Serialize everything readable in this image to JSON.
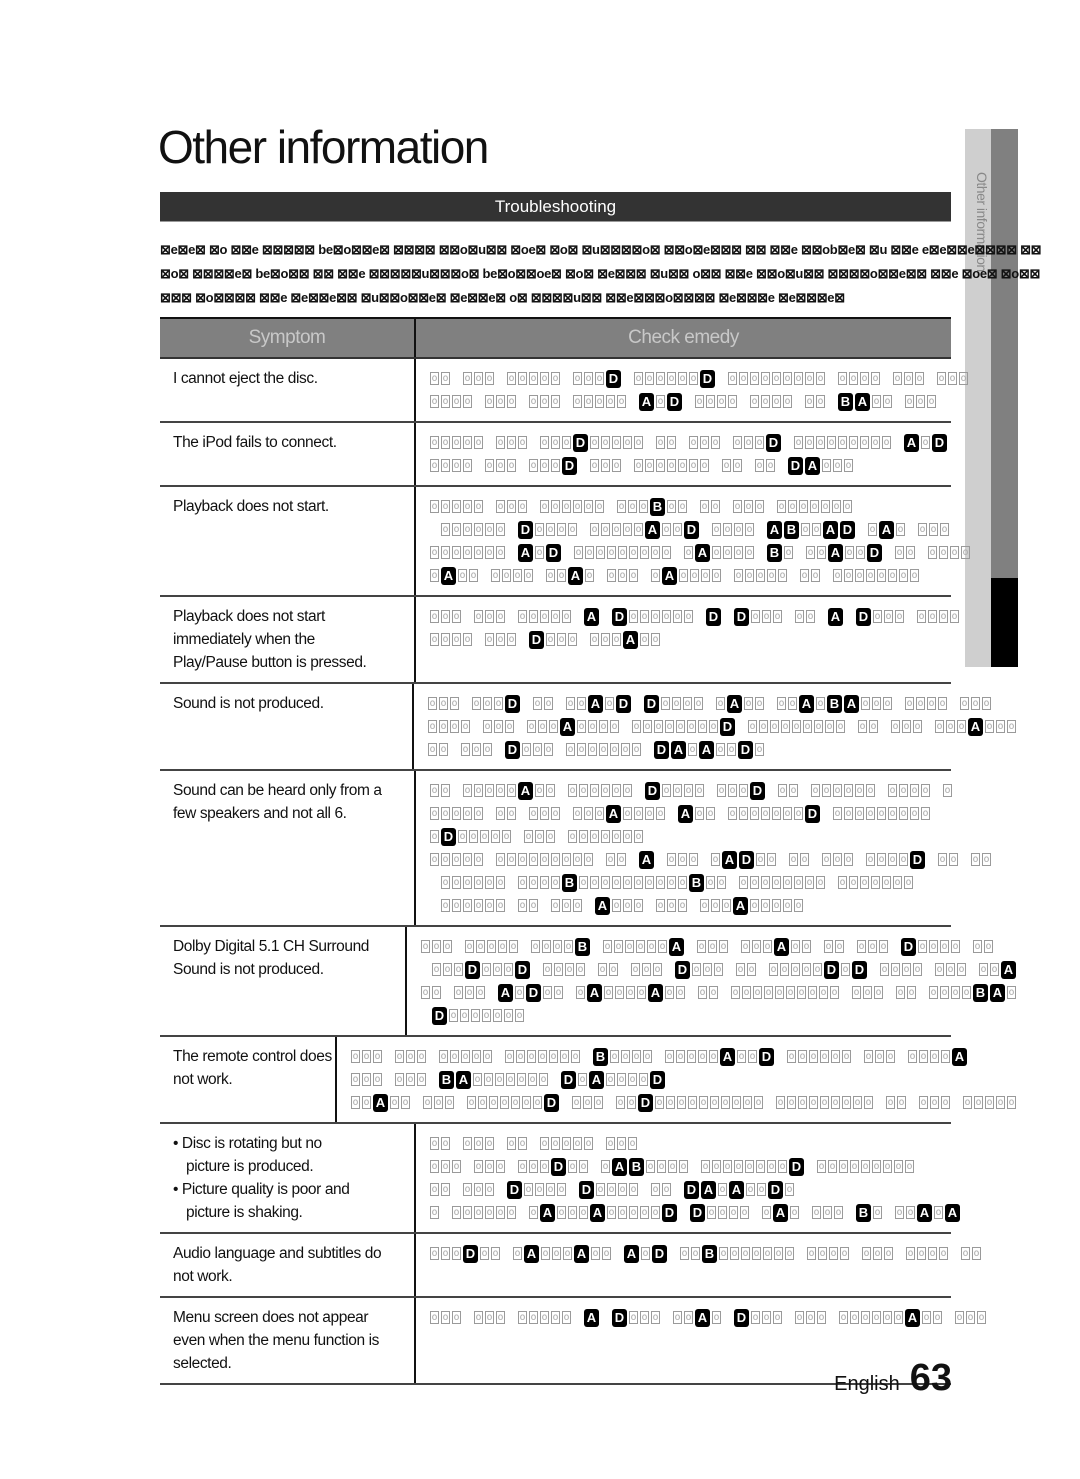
{
  "page": {
    "title": "Other information",
    "side_tab_label": "Other information",
    "section_title": "Troubleshooting",
    "intro_lines": [
      "⊠e⊠e⊠ ⊠o ⊠⊠e ⊠⊠⊠⊠⊠ be⊠o⊠⊠e⊠ ⊠⊠⊠⊠ ⊠⊠o⊠u⊠⊠ ⊠oe⊠ ⊠o⊠ ⊠u⊠⊠⊠⊠o⊠ ⊠⊠o⊠e⊠⊠⊠ ⊠⊠ ⊠⊠e ⊠⊠ob⊠e⊠ ⊠u ⊠⊠e e⊠e⊠⊠e⊠⊠⊠⊠ ⊠⊠",
      "⊠o⊠ ⊠⊠⊠⊠e⊠ be⊠o⊠⊠ ⊠⊠ ⊠⊠e ⊠⊠⊠⊠⊠u⊠⊠⊠o⊠ be⊠o⊠⊠oe⊠ ⊠o⊠ ⊠e⊠⊠⊠ ⊠u⊠⊠ o⊠⊠ ⊠⊠e ⊠⊠o⊠u⊠⊠ ⊠⊠⊠⊠o⊠⊠e⊠⊠ ⊠⊠e ⊠oe⊠ ⊠o⊠⊠",
      "⊠⊠⊠ ⊠o⊠⊠⊠⊠ ⊠⊠e ⊠e⊠⊠e⊠⊠ ⊠u⊠⊠o⊠⊠e⊠ ⊠e⊠⊠e⊠ o⊠ ⊠⊠⊠⊠u⊠⊠ ⊠⊠e⊠⊠⊠o⊠⊠⊠⊠ ⊠e⊠⊠⊠e ⊠e⊠⊠⊠e⊠"
    ],
    "table": {
      "col_symptom": "Symptom",
      "col_remedy": "Check emedy",
      "rows": [
        {
          "symptom": [
            "I cannot eject the disc."
          ],
          "remedy": [
            "oo ooo ooooo oooD ooooooD ooooooooo oooo ooo ooo",
            "oooo ooo ooo ooooo AoD oooo oooo oo BAoo ooo"
          ]
        },
        {
          "symptom": [
            "The iPod fails to connect."
          ],
          "remedy": [
            "ooooo ooo oooDooooo oo ooo oooD ooooooooo AoD",
            "oooo ooo oooD ooo ooooooo oo oo DAooo"
          ]
        },
        {
          "symptom": [
            "Playback does not start."
          ],
          "remedy": [
            "ooooo ooo oooooo oooBoo oo ooo ooooooo",
            " oooooo Doooo oooooAooD oooo ABooAD oAo ooo",
            "ooooooo AoD ooooooooo oAoooo Bo ooAooD oo oooo",
            "oAoo oooo ooAo ooo oAoooo ooooo oo oooooooo"
          ]
        },
        {
          "symptom": [
            "Playback does not start",
            "immediately when the",
            "Play/Pause button is pressed."
          ],
          "remedy": [
            "ooo ooo ooooo A Doooooo D Dooo oo A Dooo oooo",
            "oooo ooo Dooo oooAoo"
          ]
        },
        {
          "symptom": [
            "Sound is not produced."
          ],
          "remedy": [
            "ooo oooD oo ooAoD Doooo oAoo ooAoBAooo oooo ooo",
            "oooo ooo oooAoooo ooooooooD ooooooooo oo ooo oooAooo",
            "oo ooo Dooo ooooooo DAoAooDo"
          ]
        },
        {
          "symptom": [
            "Sound can be heard only from a",
            "few speakers and not all 6."
          ],
          "remedy": [
            "oo oooooAoo oooooo Doooo oooD oo oooooo oooo o",
            "ooooo oo ooo oooAoooo Aoo oooooooD ooooooooo",
            "oDooooo ooo ooooooo",
            "ooooo ooooooooo oo A ooo oADoo oo ooo ooooD oo oo",
            " oooooo ooooBooooooooooBoo oooooooo ooooooo",
            " oooooo oo ooo Aooo ooo oooAooooo"
          ]
        },
        {
          "symptom": [
            "Dolby Digital 5.1 CH Surround",
            "Sound is not produced."
          ],
          "remedy": [
            "ooo ooooo ooooB ooooooA ooo oooAoo oo ooo Doooo oo",
            " oooDoooD oooo oo ooo Dooo oo oooooDoD oooo ooo ooA",
            "oo ooo AoDoo oAooooAoo oo oooooooooo ooo oo ooooBAo",
            " Dooooooo"
          ]
        },
        {
          "symptom": [
            "The remote control does not work."
          ],
          "remedy": [
            "ooo ooo ooooo ooooooo Boooo oooooAooD oooooo ooo ooooA",
            "ooo ooo BAooooooo DoAooooD",
            "ooAoo ooo oooooooD ooo ooDoooooooooo ooooooooo oo ooo ooooo"
          ]
        },
        {
          "symptom": [
            "• Disc is rotating but no",
            "picture is produced.",
            "• Picture quality is poor and",
            "picture is shaking."
          ],
          "remedy": [
            "oo ooo oo ooooo ooo",
            "ooo ooo oooDoo oABoooo ooooooooD ooooooooo",
            "oo ooo Doooo Doooo oo DAoAooDo",
            "o oooooo oAoooAoooooD Doooo oAo ooo Bo ooAoA"
          ]
        },
        {
          "symptom": [
            "Audio language and subtitles do",
            "not work."
          ],
          "remedy": [
            "oooDoo oAoooAoo AoD ooBooooooo oooo ooo oooo oo"
          ]
        },
        {
          "symptom": [
            "Menu screen does not appear",
            "even when the menu function is",
            "selected."
          ],
          "remedy": [
            "ooo ooo ooooo A Dooo ooAo Dooo ooo ooooooAoo ooo"
          ]
        }
      ]
    },
    "footer": {
      "language": "English",
      "page_number": "63"
    }
  }
}
